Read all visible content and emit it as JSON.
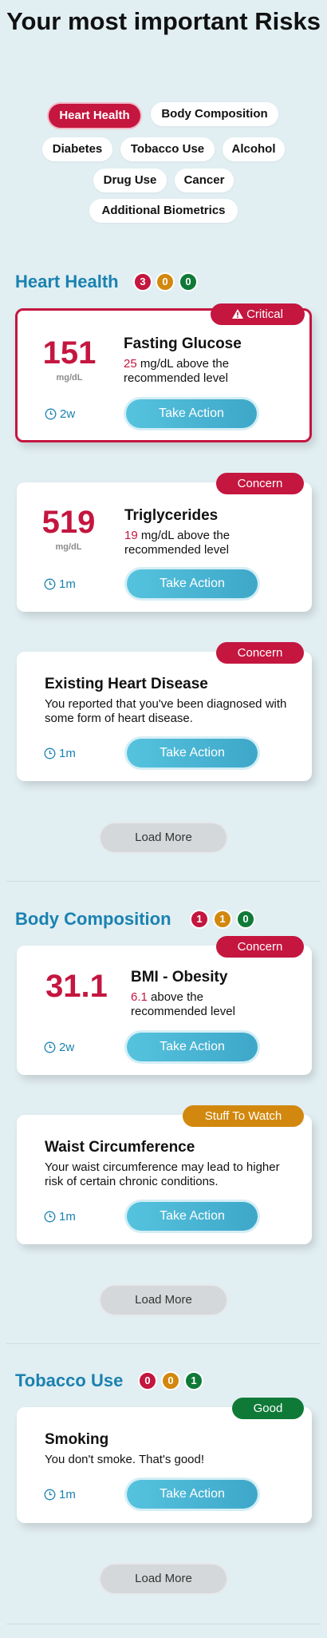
{
  "page": {
    "title": "Your most important Risks"
  },
  "filters": [
    {
      "label": "Heart Health",
      "active": true
    },
    {
      "label": "Body Composition",
      "active": false
    },
    {
      "label": "Diabetes",
      "active": false
    },
    {
      "label": "Tobacco Use",
      "active": false
    },
    {
      "label": "Alcohol",
      "active": false
    },
    {
      "label": "Drug Use",
      "active": false
    },
    {
      "label": "Cancer",
      "active": false
    },
    {
      "label": "Additional Biometrics",
      "active": false
    }
  ],
  "sections": [
    {
      "title": "Heart Health",
      "counts": {
        "critical": "3",
        "concern": "0",
        "good": "0"
      },
      "load_more": "Load More",
      "cards": [
        {
          "badge": "Critical",
          "value": "151",
          "unit": "mg/dL",
          "title": "Fasting Glucose",
          "highlight": "25",
          "desc_rest": " mg/dL above the recommended level",
          "time": "2w",
          "action": "Take Action"
        },
        {
          "badge": "Concern",
          "value": "519",
          "unit": "mg/dL",
          "title": "Triglycerides",
          "highlight": "19",
          "desc_rest": " mg/dL above the recommended level",
          "time": "1m",
          "action": "Take Action"
        },
        {
          "badge": "Concern",
          "title": "Existing Heart Disease",
          "desc": "You reported that you've been diagnosed with some form of heart disease.",
          "time": "1m",
          "action": "Take Action"
        }
      ]
    },
    {
      "title": "Body Composition",
      "counts": {
        "critical": "1",
        "concern": "1",
        "good": "0"
      },
      "load_more": "Load More",
      "cards": [
        {
          "badge": "Concern",
          "value": "31.1",
          "title": "BMI - Obesity",
          "highlight": "6.1",
          "desc_rest": " above the recommended level",
          "time": "2w",
          "action": "Take Action"
        },
        {
          "badge": "Stuff To Watch",
          "title": "Waist Circumference",
          "desc": "Your waist circumference may lead to higher risk of certain chronic conditions.",
          "time": "1m",
          "action": "Take Action"
        }
      ]
    },
    {
      "title": "Tobacco Use",
      "counts": {
        "critical": "0",
        "concern": "0",
        "good": "1"
      },
      "load_more": "Load More",
      "cards": [
        {
          "badge": "Good",
          "title": "Smoking",
          "desc": "You don't smoke. That's good!",
          "time": "1m",
          "action": "Take Action"
        }
      ]
    }
  ],
  "icons": {
    "time": "clock-icon",
    "critical": "warning-icon"
  },
  "colors": {
    "critical": "#c4163f",
    "concern": "#c4163f",
    "watch": "#d2880e",
    "good": "#0f7a37",
    "accent": "#1a82b0"
  }
}
